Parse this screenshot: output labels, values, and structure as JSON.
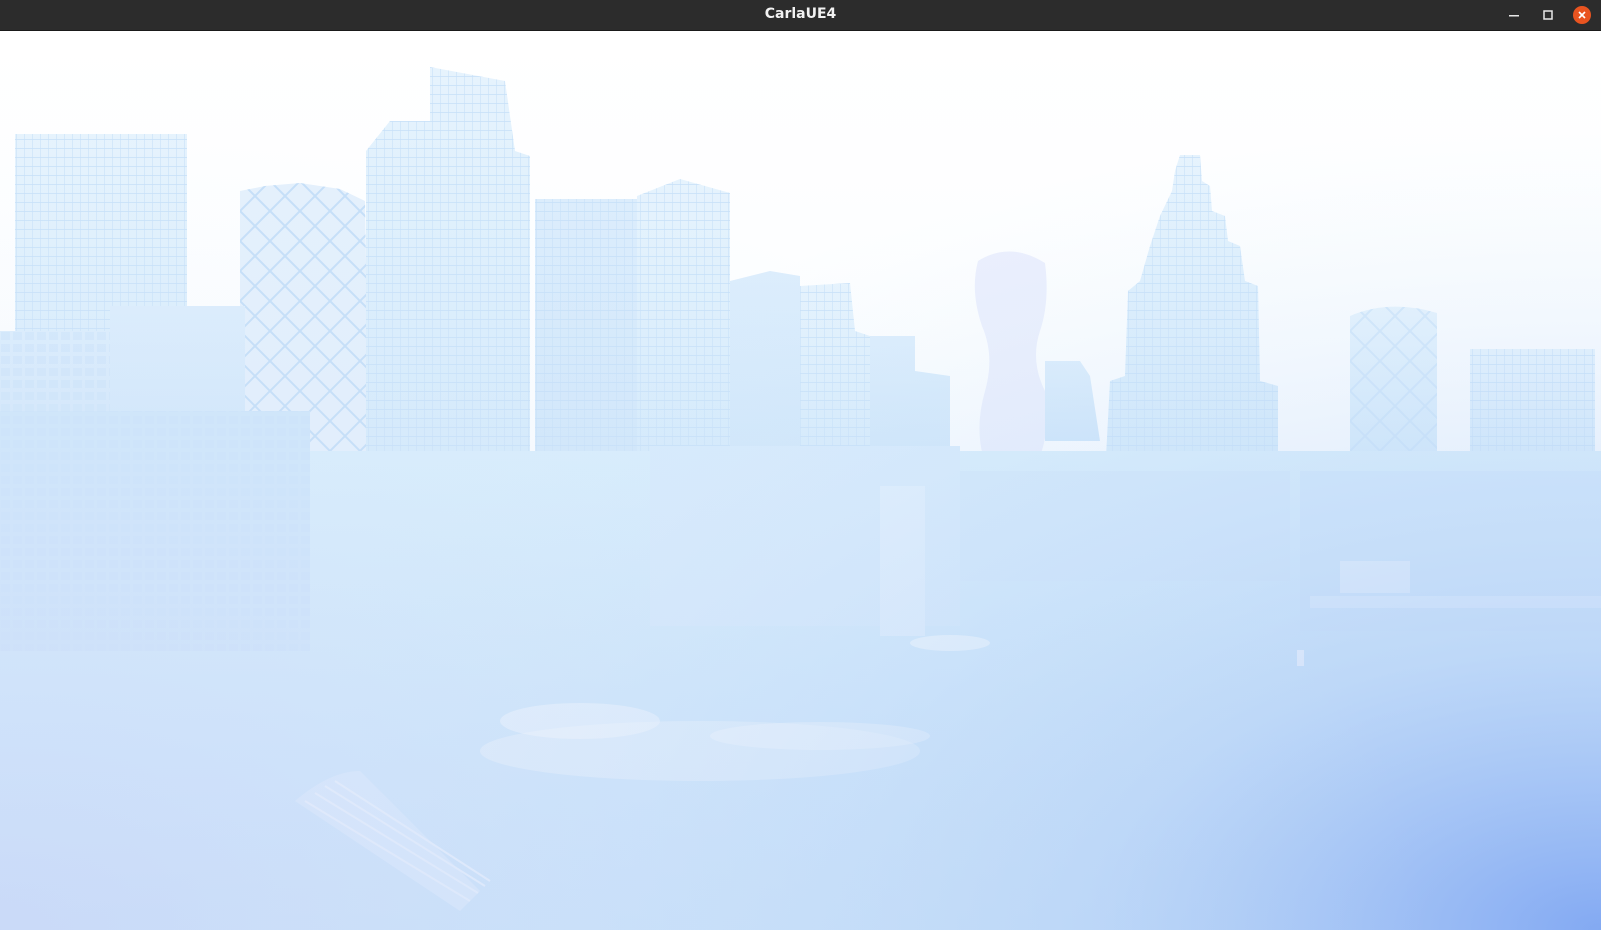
{
  "window": {
    "title": "CarlaUE4",
    "controls": {
      "minimize_icon": "minimize-icon",
      "maximize_icon": "maximize-icon",
      "close_icon": "close-icon"
    }
  },
  "colors": {
    "titlebar": "#2c2c2c",
    "title_text": "#f2f2f2",
    "close_accent": "#e95420",
    "sky": "#ffffff",
    "haze": "#d6ecfb",
    "building": "#cfe7fb",
    "corner_glow": "#7fa6f2"
  }
}
